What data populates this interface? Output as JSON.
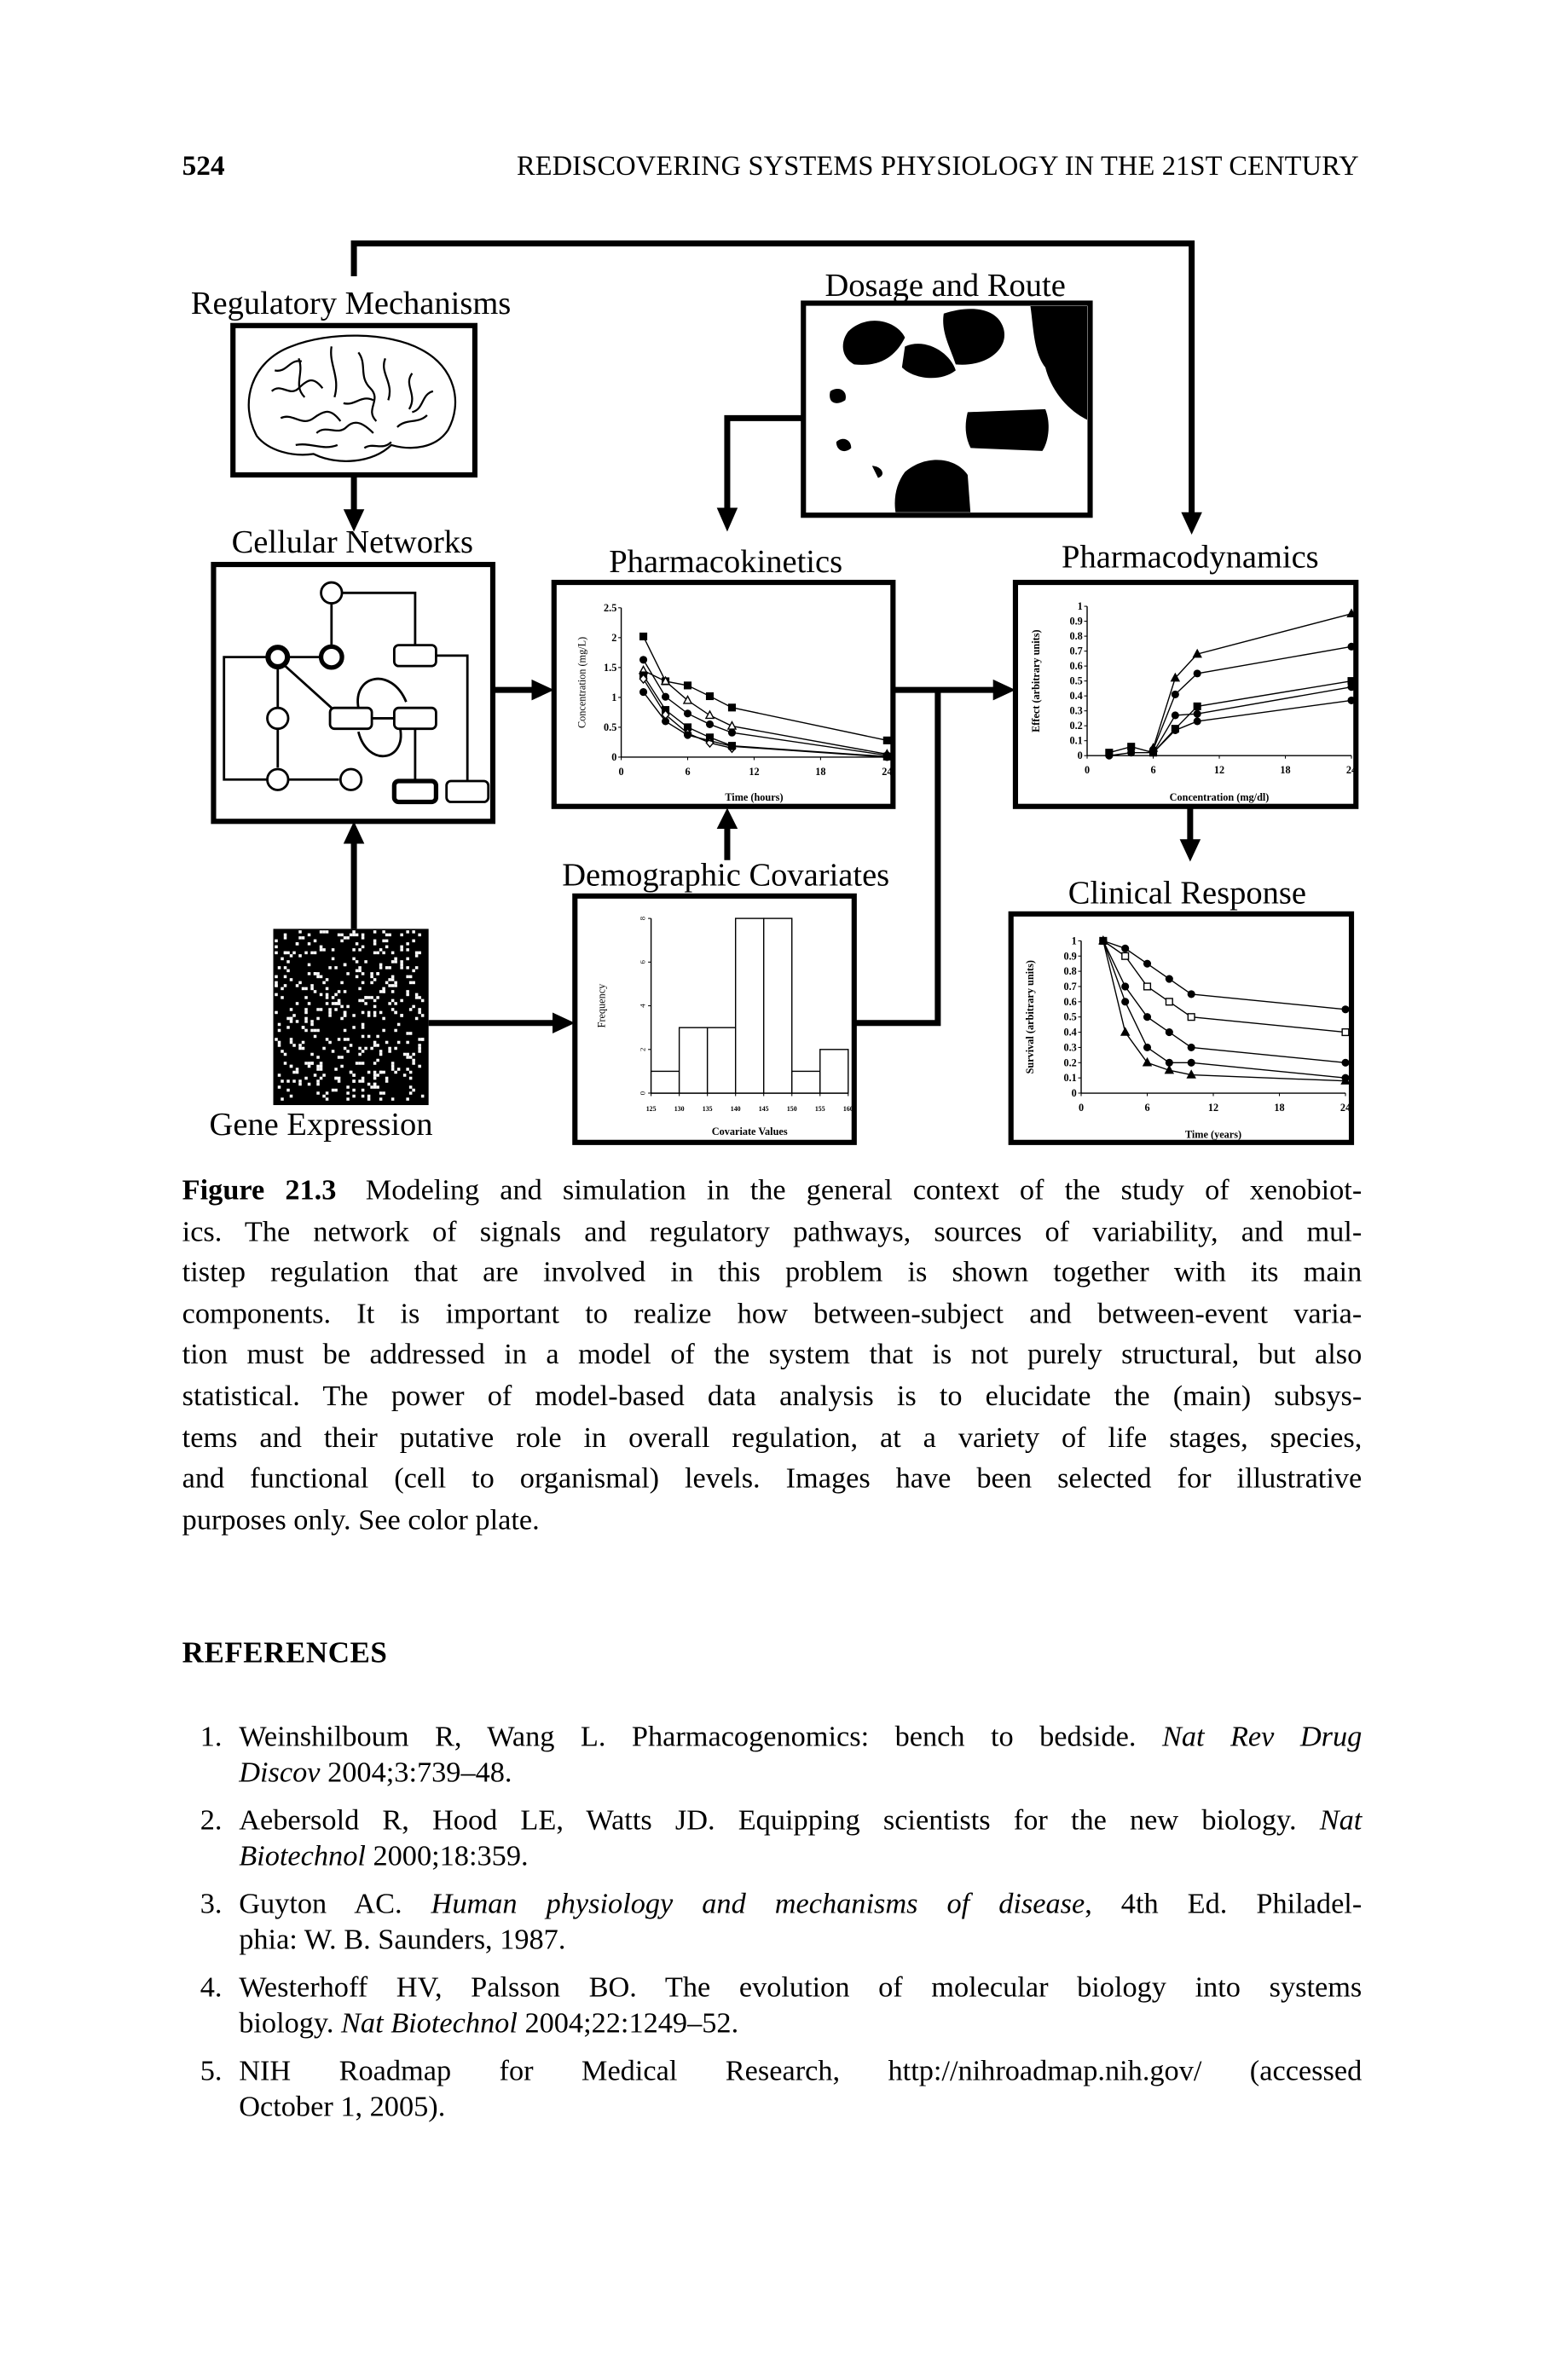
{
  "header": {
    "page_number": "524",
    "running_title": "REDISCOVERING SYSTEMS PHYSIOLOGY IN THE 21ST CENTURY"
  },
  "figure": {
    "labels": {
      "regulatory": "Regulatory Mechanisms",
      "dosage": "Dosage and Route",
      "cellular": "Cellular Networks",
      "pk": "Pharmacokinetics",
      "pd": "Pharmacodynamics",
      "demographic": "Demographic Covariates",
      "clinical": "Clinical Response",
      "gene": "Gene Expression"
    },
    "line_color": "#000000"
  },
  "chart_data": [
    {
      "id": "pk",
      "type": "line",
      "title": "Pharmacokinetics",
      "xlabel": "Time (hours)",
      "ylabel": "Concentration (mg/L)",
      "xlim": [
        0,
        24
      ],
      "ylim": [
        0,
        2.5
      ],
      "xticks": [
        0,
        6,
        12,
        18,
        24
      ],
      "yticks": [
        0,
        0.5,
        1,
        1.5,
        2,
        2.5
      ],
      "ytick_labels": [
        "0",
        "0.5",
        "1",
        "1.5",
        "2",
        "2.5"
      ],
      "grid": false,
      "series": [
        {
          "marker": "square",
          "points": [
            [
              2,
              2.02
            ],
            [
              4,
              1.27
            ],
            [
              6,
              1.2
            ],
            [
              8,
              1.02
            ],
            [
              10,
              0.83
            ],
            [
              24,
              0.28
            ]
          ]
        },
        {
          "marker": "triangle-open",
          "points": [
            [
              2,
              1.45
            ],
            [
              4,
              1.27
            ],
            [
              6,
              0.95
            ],
            [
              8,
              0.7
            ],
            [
              10,
              0.52
            ],
            [
              24,
              0.05
            ]
          ]
        },
        {
          "marker": "circle",
          "points": [
            [
              2,
              1.63
            ],
            [
              4,
              1.01
            ],
            [
              6,
              0.73
            ],
            [
              8,
              0.55
            ],
            [
              10,
              0.41
            ],
            [
              24,
              0.03
            ]
          ]
        },
        {
          "marker": "square",
          "points": [
            [
              2,
              1.37
            ],
            [
              4,
              0.79
            ],
            [
              6,
              0.5
            ],
            [
              8,
              0.33
            ],
            [
              10,
              0.19
            ],
            [
              24,
              0.01
            ]
          ]
        },
        {
          "marker": "diamond-open",
          "points": [
            [
              2,
              1.31
            ],
            [
              4,
              0.71
            ],
            [
              6,
              0.4
            ],
            [
              8,
              0.24
            ],
            [
              10,
              0.15
            ]
          ]
        },
        {
          "marker": "circle",
          "points": [
            [
              2,
              1.09
            ],
            [
              4,
              0.6
            ],
            [
              6,
              0.37
            ],
            [
              10,
              0.18
            ],
            [
              24,
              0
            ]
          ]
        }
      ]
    },
    {
      "id": "pd",
      "type": "line",
      "title": "Pharmacodynamics",
      "xlabel": "Concentration (mg/dl)",
      "ylabel": "Effect (arbitrary units)",
      "xlim": [
        0,
        24
      ],
      "ylim": [
        0,
        1
      ],
      "xticks": [
        0,
        6,
        12,
        18,
        24
      ],
      "yticks": [
        0,
        0.1,
        0.2,
        0.3,
        0.4,
        0.5,
        0.6,
        0.7,
        0.8,
        0.9,
        1
      ],
      "ytick_labels": [
        "0",
        "0.1",
        "0.2",
        "0.3",
        "0.4",
        "0.5",
        "0.6",
        "0.7",
        "0.8",
        "0.9",
        "1"
      ],
      "grid": false,
      "series": [
        {
          "marker": "triangle",
          "points": [
            [
              6,
              0.05
            ],
            [
              8,
              0.52
            ],
            [
              10,
              0.68
            ],
            [
              24,
              0.95
            ]
          ]
        },
        {
          "marker": "circle",
          "points": [
            [
              6,
              0.04
            ],
            [
              8,
              0.41
            ],
            [
              10,
              0.55
            ],
            [
              24,
              0.73
            ]
          ]
        },
        {
          "marker": "square",
          "points": [
            [
              2,
              0.02
            ],
            [
              4,
              0.06
            ],
            [
              6,
              0.02
            ],
            [
              8,
              0.18
            ],
            [
              10,
              0.33
            ],
            [
              24,
              0.5
            ]
          ]
        },
        {
          "marker": "circle",
          "points": [
            [
              6,
              0.02
            ],
            [
              8,
              0.27
            ],
            [
              10,
              0.28
            ],
            [
              24,
              0.46
            ]
          ]
        },
        {
          "marker": "circle",
          "points": [
            [
              2,
              0
            ],
            [
              4,
              0.02
            ],
            [
              6,
              0.02
            ],
            [
              8,
              0.17
            ],
            [
              10,
              0.23
            ],
            [
              24,
              0.37
            ]
          ]
        }
      ]
    },
    {
      "id": "cr",
      "type": "line",
      "title": "Clinical Response",
      "xlabel": "Time (years)",
      "ylabel": "Survival (arbitrary units)",
      "xlim": [
        0,
        24
      ],
      "ylim": [
        0,
        1
      ],
      "xticks": [
        0,
        6,
        12,
        18,
        24
      ],
      "yticks": [
        0,
        0.1,
        0.2,
        0.3,
        0.4,
        0.5,
        0.6,
        0.7,
        0.8,
        0.9,
        1
      ],
      "ytick_labels": [
        "0",
        "0.1",
        "0.2",
        "0.3",
        "0.4",
        "0.5",
        "0.6",
        "0.7",
        "0.8",
        "0.9",
        "1"
      ],
      "grid": false,
      "series": [
        {
          "marker": "circle",
          "points": [
            [
              2,
              1
            ],
            [
              4,
              0.95
            ],
            [
              6,
              0.85
            ],
            [
              8,
              0.75
            ],
            [
              10,
              0.65
            ],
            [
              24,
              0.55
            ]
          ]
        },
        {
          "marker": "square-open",
          "points": [
            [
              2,
              1
            ],
            [
              4,
              0.9
            ],
            [
              6,
              0.7
            ],
            [
              8,
              0.6
            ],
            [
              10,
              0.5
            ],
            [
              24,
              0.4
            ]
          ]
        },
        {
          "marker": "circle",
          "points": [
            [
              2,
              1
            ],
            [
              4,
              0.7
            ],
            [
              6,
              0.5
            ],
            [
              8,
              0.4
            ],
            [
              10,
              0.3
            ],
            [
              24,
              0.2
            ]
          ]
        },
        {
          "marker": "circle",
          "points": [
            [
              2,
              1
            ],
            [
              4,
              0.6
            ],
            [
              6,
              0.3
            ],
            [
              8,
              0.2
            ],
            [
              10,
              0.2
            ],
            [
              24,
              0.1
            ]
          ]
        },
        {
          "marker": "triangle",
          "points": [
            [
              2,
              1
            ],
            [
              4,
              0.4
            ],
            [
              6,
              0.2
            ],
            [
              8,
              0.15
            ],
            [
              10,
              0.12
            ],
            [
              24,
              0.08
            ]
          ]
        }
      ]
    },
    {
      "id": "hist",
      "type": "bar",
      "title": "Demographic Covariates",
      "xlabel": "Covariate Values",
      "ylabel": "Frequency",
      "xlim": [
        125,
        160
      ],
      "ylim": [
        0,
        8
      ],
      "bin_edges": [
        125,
        130,
        135,
        140,
        145,
        150,
        155,
        160
      ],
      "values": [
        1,
        3,
        3,
        8,
        8,
        1,
        2
      ],
      "xticks": [
        125,
        130,
        135,
        140,
        145,
        150,
        155,
        160
      ],
      "yticks": [
        0,
        2,
        4,
        6,
        8
      ],
      "ytick_labels": [
        "0",
        "2",
        "4",
        "6",
        "8"
      ],
      "grid": false
    }
  ],
  "caption": {
    "label": "Figure 21.3",
    "lines": [
      "Modeling and simulation in the general context of the study of xenobiot-",
      "ics. The network of signals and regulatory pathways, sources of variability, and mul-",
      "tistep regulation that are involved in this problem is shown together with its main",
      "components. It is important to realize how between-subject and between-event varia-",
      "tion must be addressed in a model of the system that is not purely structural, but also",
      "statistical. The power of model-based data analysis is to elucidate the (main) subsys-",
      "tems and their putative role in overall regulation, at a variety of life stages, species,",
      "and functional (cell to organismal) levels. Images have been selected for illustrative",
      "purposes only. See color plate."
    ]
  },
  "references": {
    "heading": "REFERENCES",
    "items": [
      {
        "num": "1.",
        "lines": [
          [
            {
              "t": "Weinshilboum R, Wang L. Pharmacogenomics: bench to bedside. "
            },
            {
              "t": "Nat Rev Drug",
              "i": true
            }
          ],
          [
            {
              "t": "Discov",
              "i": true
            },
            {
              "t": " 2004;3:739–48."
            }
          ]
        ]
      },
      {
        "num": "2.",
        "lines": [
          [
            {
              "t": "Aebersold R, Hood LE, Watts JD. Equipping scientists for the new biology. "
            },
            {
              "t": "Nat",
              "i": true
            }
          ],
          [
            {
              "t": "Biotechnol",
              "i": true
            },
            {
              "t": " 2000;18:359."
            }
          ]
        ]
      },
      {
        "num": "3.",
        "lines": [
          [
            {
              "t": "Guyton AC. "
            },
            {
              "t": "Human physiology and mechanisms of disease",
              "i": true
            },
            {
              "t": ", 4th Ed. Philadel-"
            }
          ],
          [
            {
              "t": "phia: W. B. Saunders, 1987."
            }
          ]
        ]
      },
      {
        "num": "4.",
        "lines": [
          [
            {
              "t": "Westerhoff HV, Palsson BO. The evolution of molecular biology into systems"
            }
          ],
          [
            {
              "t": "biology. "
            },
            {
              "t": "Nat Biotechnol",
              "i": true
            },
            {
              "t": " 2004;22:1249–52."
            }
          ]
        ]
      },
      {
        "num": "5.",
        "lines": [
          [
            {
              "t": "NIH Roadmap for Medical Research, http://nihroadmap.nih.gov/ (accessed"
            }
          ],
          [
            {
              "t": "October 1, 2005)."
            }
          ]
        ]
      }
    ]
  }
}
